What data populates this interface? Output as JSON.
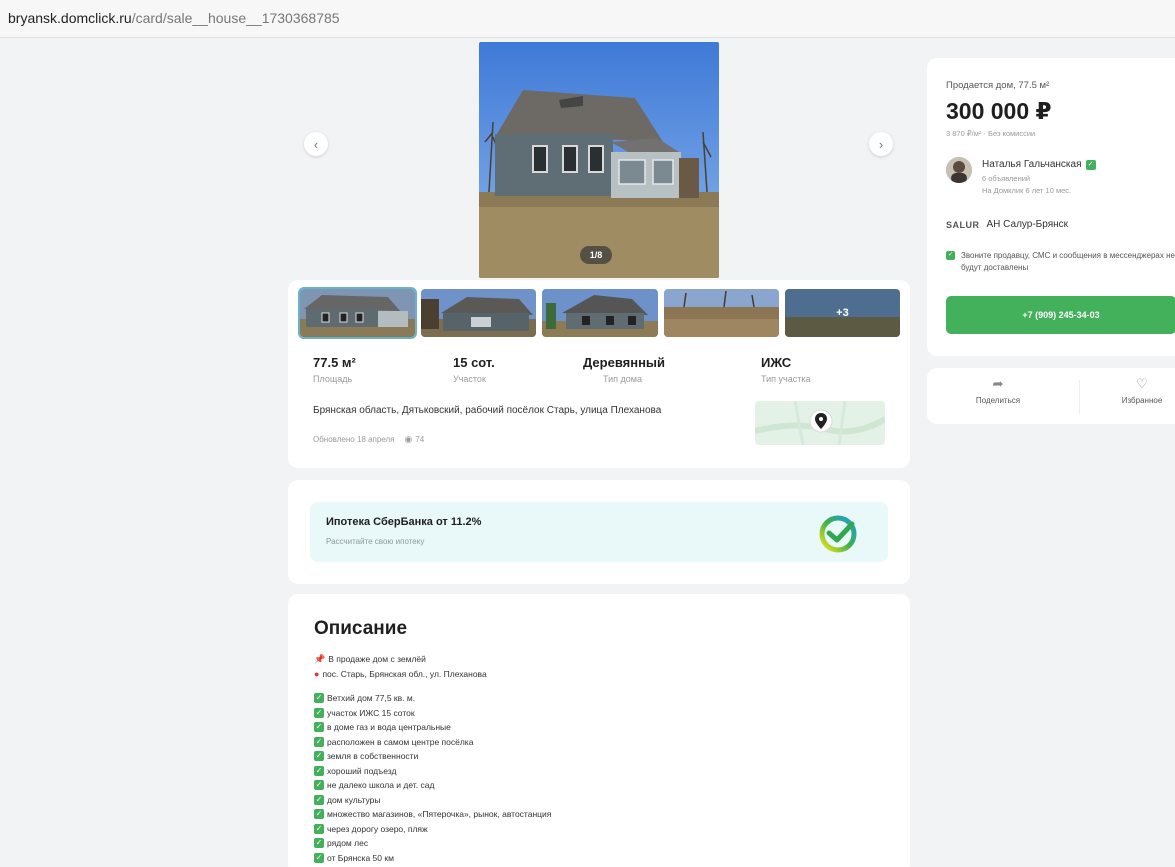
{
  "browser": {
    "url_host": "bryansk.domclick.ru",
    "url_path": "/card/sale__house__1730368785"
  },
  "gallery": {
    "prev_icon": "chevron-left-icon",
    "next_icon": "chevron-right-icon",
    "counter": "1/8",
    "more_photos": "+3"
  },
  "facts": [
    {
      "value": "77.5 м²",
      "label": "Площадь"
    },
    {
      "value": "15 сот.",
      "label": "Участок"
    },
    {
      "value": "Деревянный",
      "label": "Тип дома"
    },
    {
      "value": "ИЖС",
      "label": "Тип участка"
    }
  ],
  "address": "Брянская область, Дятьковский, рабочий посёлок Старь, улица Плеханова",
  "meta": {
    "updated": "Обновлено 18 апреля",
    "views": "74"
  },
  "mortgage": {
    "title": "Ипотека СберБанка от 11.2%",
    "subtitle": "Рассчитайте свою ипотеку"
  },
  "description": {
    "title": "Описание",
    "intro": [
      "В продаже дом с землёй",
      "пос. Старь, Брянская обл., ул. Плеханова"
    ],
    "items": [
      "Ветхий дом 77,5 кв. м.",
      "участок ИЖС 15 соток",
      "в доме газ и вода центральные",
      "расположен в самом центре посёлка",
      "земля в собственности",
      "хороший подъезд",
      "не далеко школа и дет. сад",
      "дом культуры",
      "множество магазинов, «Пятерочка», рынок, автостанция",
      "через дорогу озеро, пляж",
      "рядом лес",
      "от Брянска 50 км"
    ]
  },
  "seller": {
    "type": "Продается дом, 77.5 м²",
    "price": "300 000 ₽",
    "price_per": "3 870 ₽/м²  ·  Без комиссии",
    "name": "Наталья Гальчанская",
    "ads_count": "6 объявлений",
    "since": "На Домклик 6 лет 10 мес.",
    "agency_logo": "SALUR",
    "agency": "АН Салур-Брянск",
    "notice": "Звоните продавцу, СМС и сообщения в мессенджерах не будут доставлены",
    "phone": "+7 (909) 245-34-03"
  },
  "actions": {
    "share": "Поделиться",
    "favorite": "Избранное"
  }
}
